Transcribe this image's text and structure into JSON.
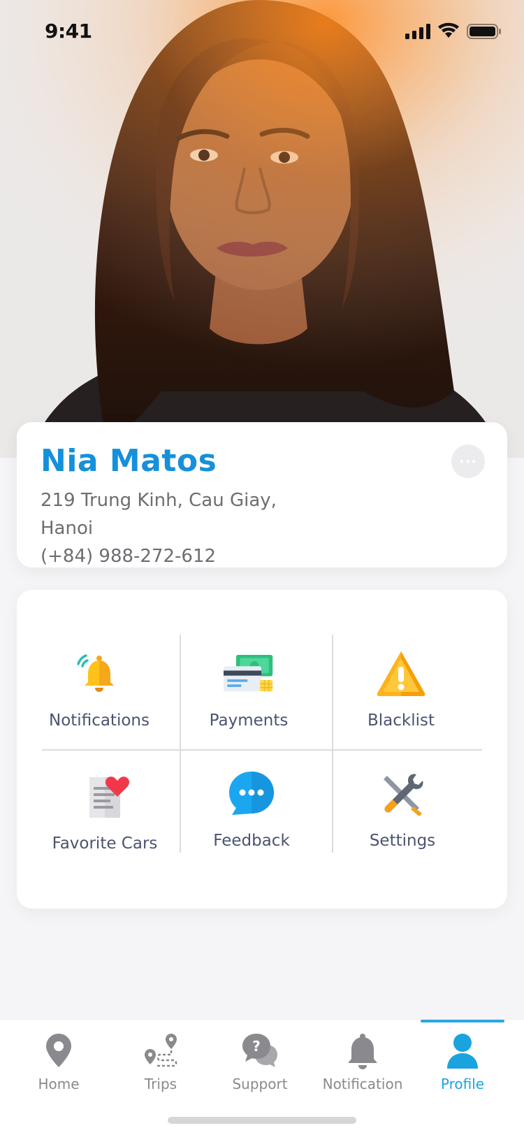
{
  "status_bar": {
    "time": "9:41"
  },
  "profile": {
    "name": "Nia Matos",
    "address": "219 Trung Kinh, Cau Giay, Hanoi",
    "phone": "(+84) 988-272-612",
    "more_label": "···"
  },
  "menu": {
    "items": [
      {
        "label": "Notifications",
        "icon": "bell-icon"
      },
      {
        "label": "Payments",
        "icon": "payment-icon"
      },
      {
        "label": "Blacklist",
        "icon": "warning-icon"
      },
      {
        "label": "Favorite Cars",
        "icon": "favorite-document-icon"
      },
      {
        "label": "Feedback",
        "icon": "chat-bubble-icon"
      },
      {
        "label": "Settings",
        "icon": "tools-icon"
      }
    ]
  },
  "tabbar": {
    "tabs": [
      {
        "label": "Home",
        "icon": "location-pin-icon"
      },
      {
        "label": "Trips",
        "icon": "route-icon"
      },
      {
        "label": "Support",
        "icon": "help-chat-icon"
      },
      {
        "label": "Notification",
        "icon": "bell-icon"
      },
      {
        "label": "Profile",
        "icon": "person-icon"
      }
    ],
    "active": "Profile"
  },
  "colors": {
    "accent": "#1690d9",
    "tab_active": "#1ba3dd",
    "text_secondary": "#6d6d72",
    "menu_label": "#4a5470"
  }
}
